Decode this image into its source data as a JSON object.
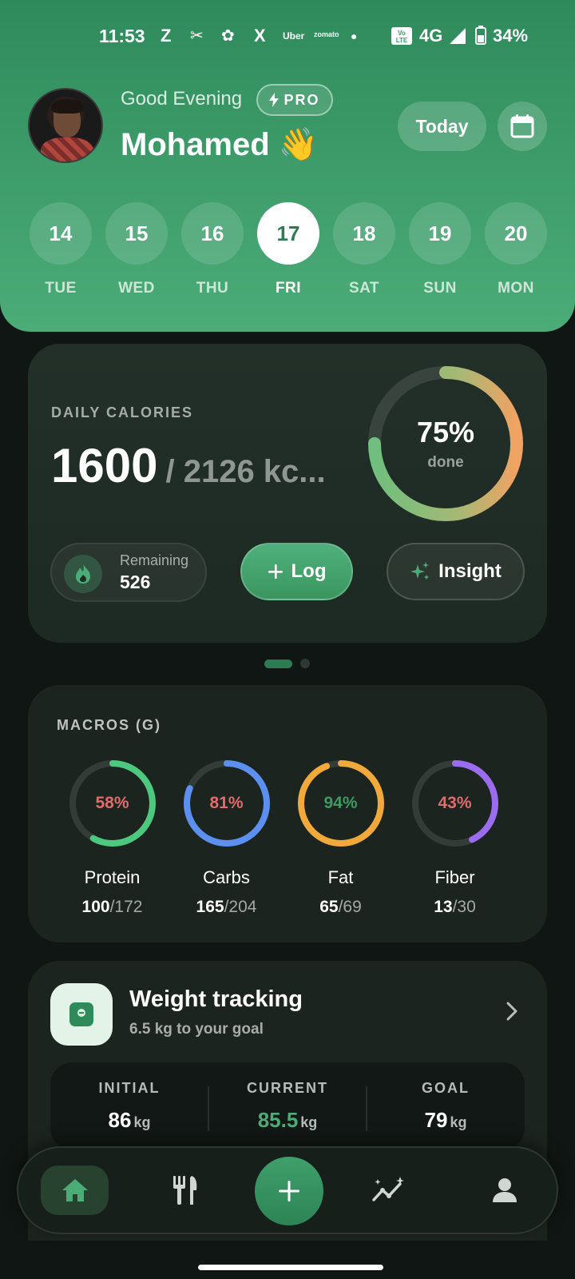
{
  "status_bar": {
    "time": "11:53",
    "icons": [
      "Z",
      "X",
      "Uber",
      "zomato"
    ],
    "network": "4G",
    "battery": "34%"
  },
  "header": {
    "greeting": "Good Evening",
    "pro_label": "PRO",
    "user_name": "Mohamed 👋",
    "today_label": "Today",
    "days": [
      {
        "num": "14",
        "name": "TUE",
        "active": false
      },
      {
        "num": "15",
        "name": "WED",
        "active": false
      },
      {
        "num": "16",
        "name": "THU",
        "active": false
      },
      {
        "num": "17",
        "name": "FRI",
        "active": true
      },
      {
        "num": "18",
        "name": "SAT",
        "active": false
      },
      {
        "num": "19",
        "name": "SUN",
        "active": false
      },
      {
        "num": "20",
        "name": "MON",
        "active": false
      }
    ]
  },
  "calories": {
    "title": "DAILY CALORIES",
    "consumed": "1600",
    "goal_text": "/ 2126 kc...",
    "progress_pct": "75%",
    "progress_fraction": 0.75,
    "progress_caption": "done",
    "remaining_label": "Remaining",
    "remaining_value": "526",
    "log_label": "Log",
    "insight_label": "Insight"
  },
  "macros": {
    "title": "MACROS (G)",
    "items": [
      {
        "name": "Protein",
        "pct": "58%",
        "fraction": 0.58,
        "current": "100",
        "target": "/172",
        "color": "#4cc97f",
        "pct_color": "#e06b6b"
      },
      {
        "name": "Carbs",
        "pct": "81%",
        "fraction": 0.81,
        "current": "165",
        "target": "/204",
        "color": "#5b8ff0",
        "pct_color": "#e06b6b"
      },
      {
        "name": "Fat",
        "pct": "94%",
        "fraction": 0.94,
        "current": "65",
        "target": "/69",
        "color": "#f2a93b",
        "pct_color": "#3e9a62"
      },
      {
        "name": "Fiber",
        "pct": "43%",
        "fraction": 0.43,
        "current": "13",
        "target": "/30",
        "color": "#9b6cf0",
        "pct_color": "#e06b6b"
      }
    ]
  },
  "weight": {
    "title": "Weight tracking",
    "subtitle": "6.5 kg to your goal",
    "stats": [
      {
        "label": "INITIAL",
        "value": "86",
        "unit": "kg"
      },
      {
        "label": "CURRENT",
        "value": "85.5",
        "unit": "kg"
      },
      {
        "label": "GOAL",
        "value": "79",
        "unit": "kg"
      }
    ]
  },
  "nav": {
    "items": [
      "home-icon",
      "meals-icon",
      "add-icon",
      "progress-icon",
      "profile-icon"
    ]
  },
  "colors": {
    "header_green": "#3d9c6a",
    "accent_green": "#4cac78",
    "background": "#101613",
    "card": "#1c2420"
  }
}
